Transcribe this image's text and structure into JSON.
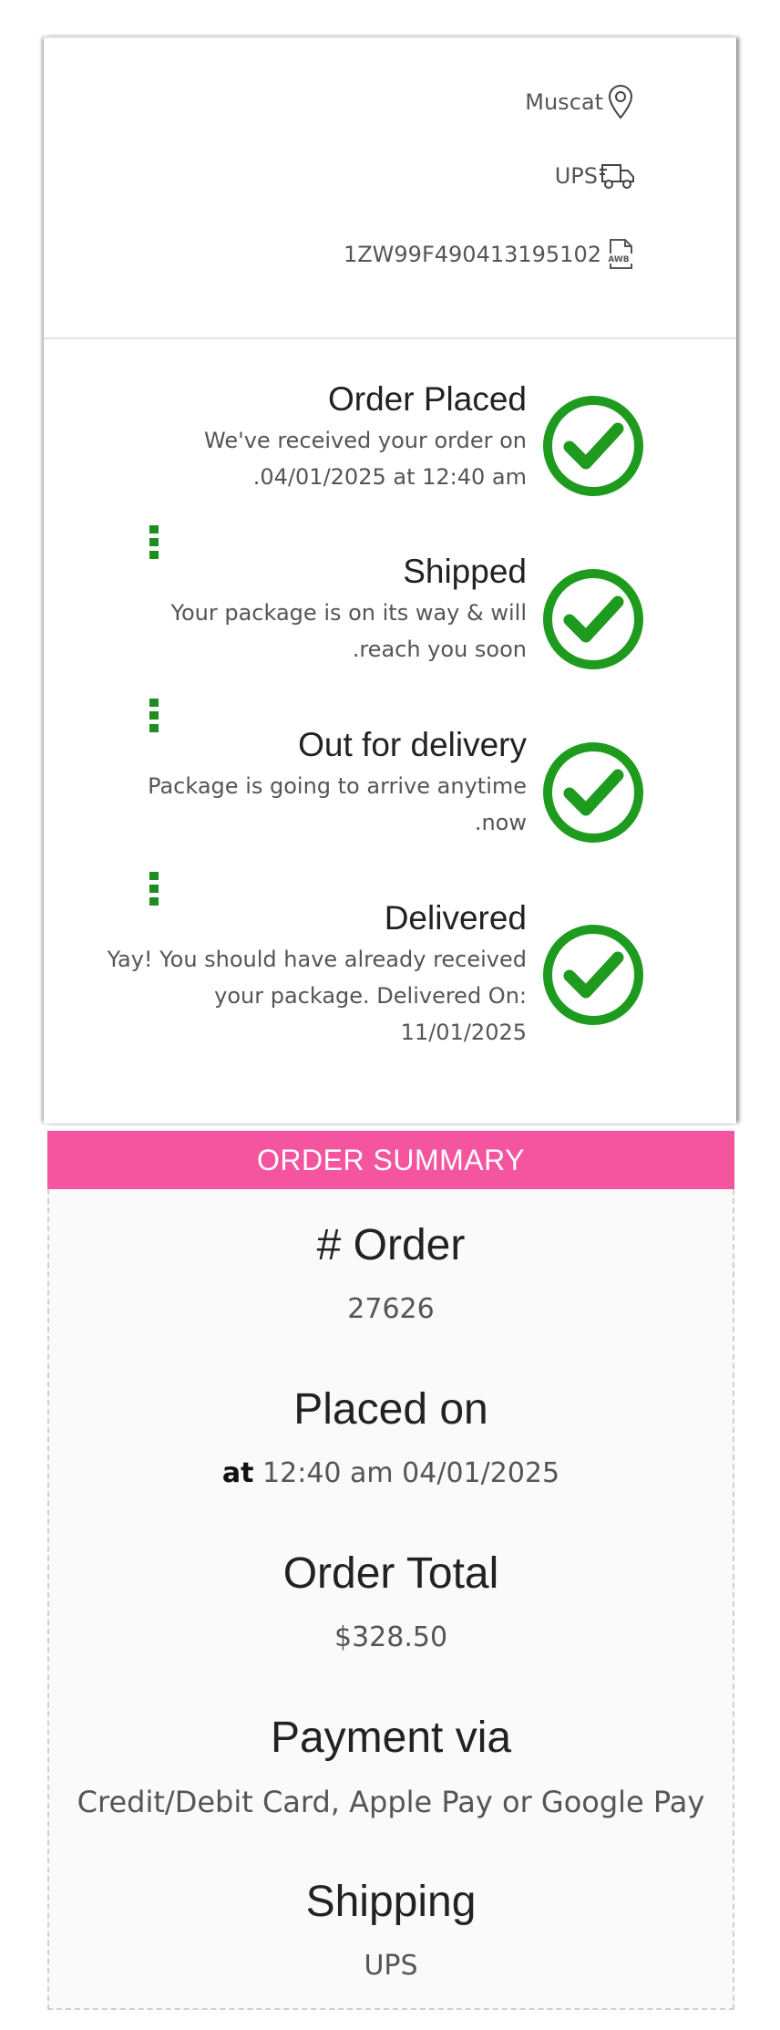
{
  "tracking": {
    "city": "Muscat",
    "carrier": "UPS",
    "awb_number": "1ZW99F490413195102",
    "icons": {
      "city": "location-pin-icon",
      "carrier": "delivery-truck-icon",
      "awb": "awb-document-icon"
    }
  },
  "steps": [
    {
      "title": "Order Placed",
      "desc_lines": [
        "We've received your order on",
        ".04/01/2025 at 12:40 am"
      ],
      "status": "complete"
    },
    {
      "title": "Shipped",
      "desc_lines": [
        "Your package is on its way & will",
        ".reach you soon"
      ],
      "status": "complete"
    },
    {
      "title": "Out for delivery",
      "desc_lines": [
        "Package is going to arrive anytime",
        ".now"
      ],
      "status": "complete"
    },
    {
      "title": "Delivered",
      "desc_lines": [
        "Yay! You should have already received",
        "your package. Delivered On:",
        "11/01/2025"
      ],
      "status": "complete"
    }
  ],
  "summary": {
    "header": "ORDER SUMMARY",
    "order_label": "# Order",
    "order_number": "27626",
    "placed_label": "Placed on",
    "placed_at_word": "at",
    "placed_value": "12:40 am 04/01/2025",
    "total_label": "Order Total",
    "total_value": "$328.50",
    "payment_label": "Payment via",
    "payment_value": "Credit/Debit Card, Apple Pay or Google Pay",
    "shipping_label": "Shipping",
    "shipping_value": "UPS"
  },
  "colors": {
    "success_green": "#1e9b1e",
    "summary_pink": "#f4559e"
  }
}
